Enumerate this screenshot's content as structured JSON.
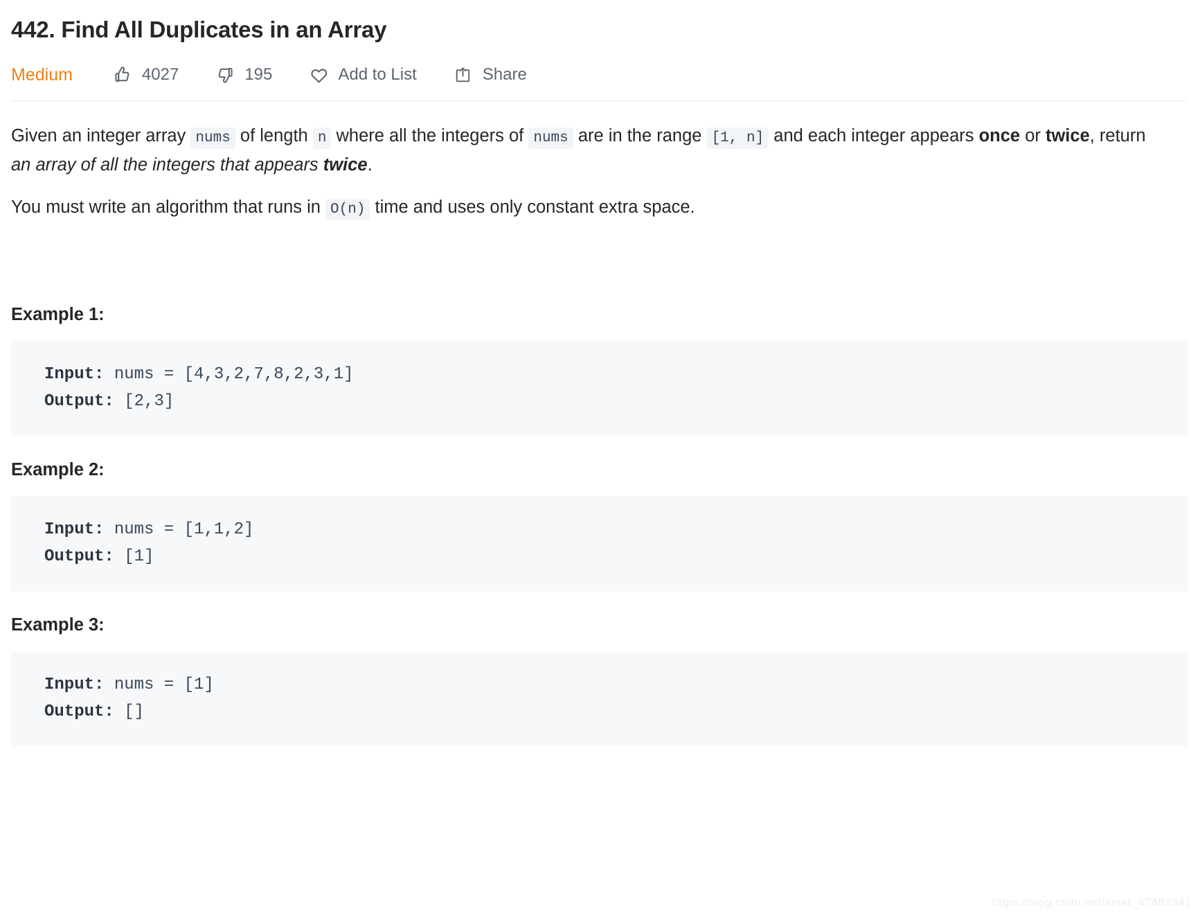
{
  "header": {
    "title": "442. Find All Duplicates in an Array",
    "difficulty": "Medium",
    "difficulty_color": "#ef8018",
    "likes": "4027",
    "dislikes": "195",
    "add_to_list_label": "Add to List",
    "share_label": "Share",
    "icons": {
      "like": "thumbs-up-icon",
      "dislike": "thumbs-down-icon",
      "favorite": "heart-icon",
      "share": "share-icon"
    }
  },
  "description": {
    "p1": {
      "t1": "Given an integer array ",
      "c1": "nums",
      "t2": " of length ",
      "c2": "n",
      "t3": " where all the integers of ",
      "c3": "nums",
      "t4": " are in the range ",
      "c4": "[1, n]",
      "t5": " and each integer appears ",
      "b1": "once",
      "t6": " or ",
      "b2": "twice",
      "t7": ", return ",
      "i1": "an array of all the integers that appears ",
      "bi1": "twice",
      "t8": "."
    },
    "p2": {
      "t1": "You must write an algorithm that runs in ",
      "c1": "O(n)",
      "t2": " time and uses only constant extra space."
    }
  },
  "examples": [
    {
      "heading": "Example 1:",
      "input_label": "Input:",
      "input_value": " nums = [4,3,2,7,8,2,3,1]",
      "output_label": "Output:",
      "output_value": " [2,3]"
    },
    {
      "heading": "Example 2:",
      "input_label": "Input:",
      "input_value": " nums = [1,1,2]",
      "output_label": "Output:",
      "output_value": " [1]"
    },
    {
      "heading": "Example 3:",
      "input_label": "Input:",
      "input_value": " nums = [1]",
      "output_label": "Output:",
      "output_value": " []"
    }
  ],
  "watermark": {
    "text": "https://blog.csdn.net/sinat_42483341"
  }
}
